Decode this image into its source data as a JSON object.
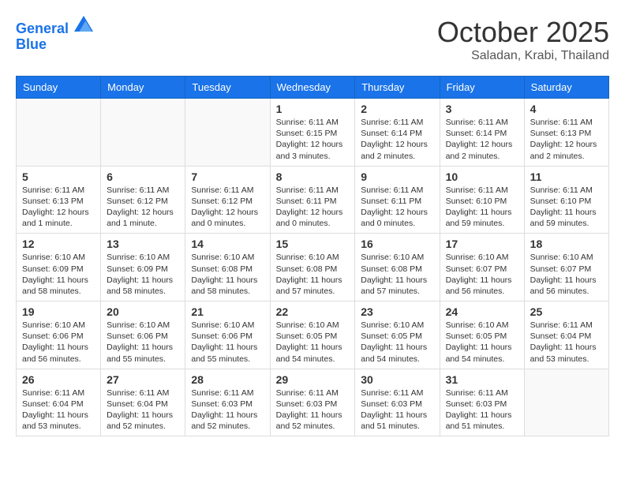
{
  "logo": {
    "line1": "General",
    "line2": "Blue"
  },
  "title": "October 2025",
  "location": "Saladan, Krabi, Thailand",
  "days_of_week": [
    "Sunday",
    "Monday",
    "Tuesday",
    "Wednesday",
    "Thursday",
    "Friday",
    "Saturday"
  ],
  "weeks": [
    [
      {
        "day": "",
        "info": ""
      },
      {
        "day": "",
        "info": ""
      },
      {
        "day": "",
        "info": ""
      },
      {
        "day": "1",
        "info": "Sunrise: 6:11 AM\nSunset: 6:15 PM\nDaylight: 12 hours and 3 minutes."
      },
      {
        "day": "2",
        "info": "Sunrise: 6:11 AM\nSunset: 6:14 PM\nDaylight: 12 hours and 2 minutes."
      },
      {
        "day": "3",
        "info": "Sunrise: 6:11 AM\nSunset: 6:14 PM\nDaylight: 12 hours and 2 minutes."
      },
      {
        "day": "4",
        "info": "Sunrise: 6:11 AM\nSunset: 6:13 PM\nDaylight: 12 hours and 2 minutes."
      }
    ],
    [
      {
        "day": "5",
        "info": "Sunrise: 6:11 AM\nSunset: 6:13 PM\nDaylight: 12 hours and 1 minute."
      },
      {
        "day": "6",
        "info": "Sunrise: 6:11 AM\nSunset: 6:12 PM\nDaylight: 12 hours and 1 minute."
      },
      {
        "day": "7",
        "info": "Sunrise: 6:11 AM\nSunset: 6:12 PM\nDaylight: 12 hours and 0 minutes."
      },
      {
        "day": "8",
        "info": "Sunrise: 6:11 AM\nSunset: 6:11 PM\nDaylight: 12 hours and 0 minutes."
      },
      {
        "day": "9",
        "info": "Sunrise: 6:11 AM\nSunset: 6:11 PM\nDaylight: 12 hours and 0 minutes."
      },
      {
        "day": "10",
        "info": "Sunrise: 6:11 AM\nSunset: 6:10 PM\nDaylight: 11 hours and 59 minutes."
      },
      {
        "day": "11",
        "info": "Sunrise: 6:11 AM\nSunset: 6:10 PM\nDaylight: 11 hours and 59 minutes."
      }
    ],
    [
      {
        "day": "12",
        "info": "Sunrise: 6:10 AM\nSunset: 6:09 PM\nDaylight: 11 hours and 58 minutes."
      },
      {
        "day": "13",
        "info": "Sunrise: 6:10 AM\nSunset: 6:09 PM\nDaylight: 11 hours and 58 minutes."
      },
      {
        "day": "14",
        "info": "Sunrise: 6:10 AM\nSunset: 6:08 PM\nDaylight: 11 hours and 58 minutes."
      },
      {
        "day": "15",
        "info": "Sunrise: 6:10 AM\nSunset: 6:08 PM\nDaylight: 11 hours and 57 minutes."
      },
      {
        "day": "16",
        "info": "Sunrise: 6:10 AM\nSunset: 6:08 PM\nDaylight: 11 hours and 57 minutes."
      },
      {
        "day": "17",
        "info": "Sunrise: 6:10 AM\nSunset: 6:07 PM\nDaylight: 11 hours and 56 minutes."
      },
      {
        "day": "18",
        "info": "Sunrise: 6:10 AM\nSunset: 6:07 PM\nDaylight: 11 hours and 56 minutes."
      }
    ],
    [
      {
        "day": "19",
        "info": "Sunrise: 6:10 AM\nSunset: 6:06 PM\nDaylight: 11 hours and 56 minutes."
      },
      {
        "day": "20",
        "info": "Sunrise: 6:10 AM\nSunset: 6:06 PM\nDaylight: 11 hours and 55 minutes."
      },
      {
        "day": "21",
        "info": "Sunrise: 6:10 AM\nSunset: 6:06 PM\nDaylight: 11 hours and 55 minutes."
      },
      {
        "day": "22",
        "info": "Sunrise: 6:10 AM\nSunset: 6:05 PM\nDaylight: 11 hours and 54 minutes."
      },
      {
        "day": "23",
        "info": "Sunrise: 6:10 AM\nSunset: 6:05 PM\nDaylight: 11 hours and 54 minutes."
      },
      {
        "day": "24",
        "info": "Sunrise: 6:10 AM\nSunset: 6:05 PM\nDaylight: 11 hours and 54 minutes."
      },
      {
        "day": "25",
        "info": "Sunrise: 6:11 AM\nSunset: 6:04 PM\nDaylight: 11 hours and 53 minutes."
      }
    ],
    [
      {
        "day": "26",
        "info": "Sunrise: 6:11 AM\nSunset: 6:04 PM\nDaylight: 11 hours and 53 minutes."
      },
      {
        "day": "27",
        "info": "Sunrise: 6:11 AM\nSunset: 6:04 PM\nDaylight: 11 hours and 52 minutes."
      },
      {
        "day": "28",
        "info": "Sunrise: 6:11 AM\nSunset: 6:03 PM\nDaylight: 11 hours and 52 minutes."
      },
      {
        "day": "29",
        "info": "Sunrise: 6:11 AM\nSunset: 6:03 PM\nDaylight: 11 hours and 52 minutes."
      },
      {
        "day": "30",
        "info": "Sunrise: 6:11 AM\nSunset: 6:03 PM\nDaylight: 11 hours and 51 minutes."
      },
      {
        "day": "31",
        "info": "Sunrise: 6:11 AM\nSunset: 6:03 PM\nDaylight: 11 hours and 51 minutes."
      },
      {
        "day": "",
        "info": ""
      }
    ]
  ]
}
